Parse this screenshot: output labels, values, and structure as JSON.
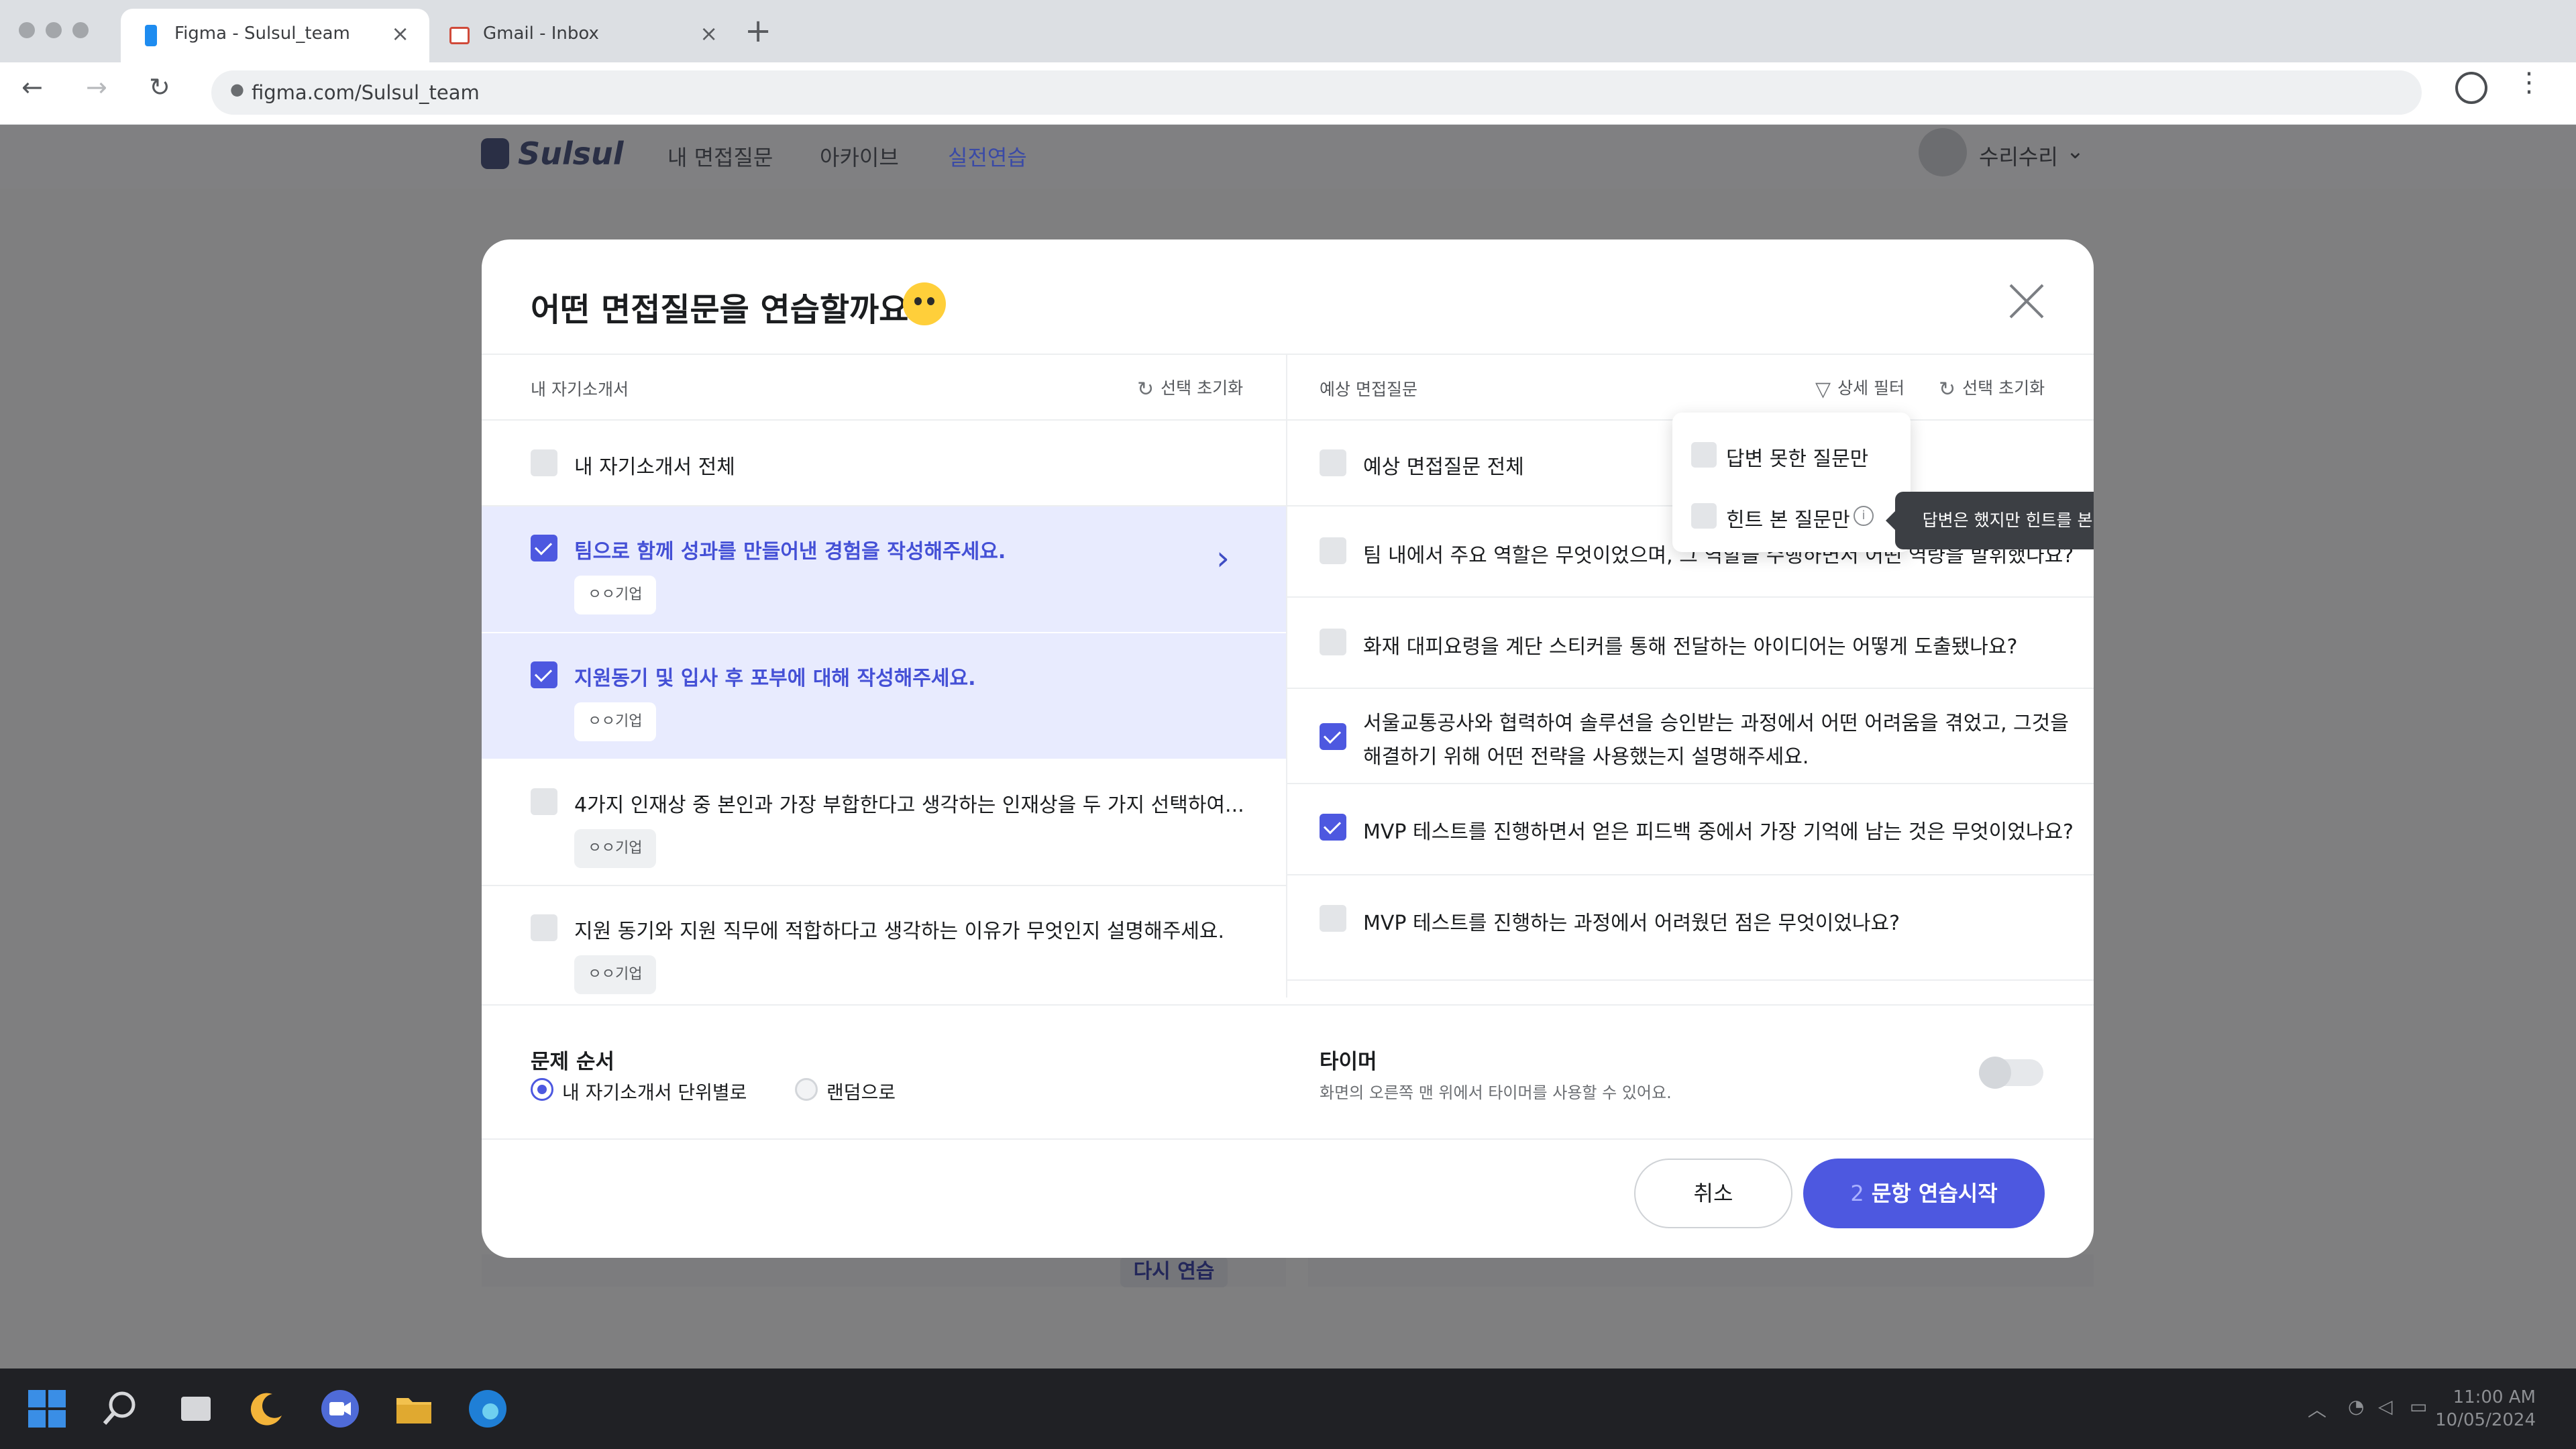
{
  "browser": {
    "tabs": [
      {
        "title": "Figma - Sulsul_team",
        "close": "×"
      },
      {
        "title": "Gmail - Inbox",
        "close": "×"
      }
    ],
    "new_tab": "+",
    "url": "figma.com/Sulsul_team",
    "back": "←",
    "forward": "→",
    "reload": "↻",
    "menu": "⋮"
  },
  "app": {
    "logo": "Sulsul",
    "nav": [
      "내 면접질문",
      "아카이브",
      "실전연습"
    ],
    "active_nav": "실전연습",
    "user": "수리수리",
    "user_chevron": "⌄",
    "retry_label": "다시 연습"
  },
  "modal": {
    "title": "어떤 면접질문을 연습할까요?",
    "left": {
      "header": "내 자기소개서",
      "reset_label": "선택 초기화",
      "all_label": "내 자기소개서 전체",
      "items": [
        {
          "text": "팀으로 함께 성과를 만들어낸 경험을 작성해주세요.",
          "company": "ㅇㅇ기업",
          "checked": true
        },
        {
          "text": "지원동기 및 입사 후 포부에 대해 작성해주세요.",
          "company": "ㅇㅇ기업",
          "checked": true
        },
        {
          "text": "4가지 인재상 중 본인과 가장 부합한다고 생각하는 인재상을 두 가지 선택하여...",
          "company": "ㅇㅇ기업",
          "checked": false
        },
        {
          "text": "지원 동기와 지원 직무에 적합하다고 생각하는 이유가 무엇인지 설명해주세요.",
          "company": "ㅇㅇ기업",
          "checked": false
        }
      ]
    },
    "right": {
      "header": "예상 면접질문",
      "filter_label": "상세 필터",
      "reset_label": "선택 초기화",
      "all_label": "예상 면접질문 전체",
      "items": [
        {
          "lines": [
            "팀 내에서 주요 역할은 무엇이었으며, 그 역할을 수행하면서 어떤 역량을 발휘했나요?"
          ],
          "checked": false
        },
        {
          "lines": [
            "화재 대피요령을 계단 스티커를 통해 전달하는 아이디어는 어떻게 도출됐나요?"
          ],
          "checked": false
        },
        {
          "lines": [
            "서울교통공사와 협력하여 솔루션을 승인받는 과정에서 어떤 어려움을 겪었고, 그것을",
            "해결하기 위해 어떤 전략을 사용했는지 설명해주세요."
          ],
          "checked": true
        },
        {
          "lines": [
            "MVP 테스트를 진행하면서 얻은 피드백 중에서 가장 기억에 남는 것은 무엇이었나요?"
          ],
          "checked": true
        },
        {
          "lines": [
            "MVP 테스트를 진행하는 과정에서 어려웠던 점은 무엇이었나요?"
          ],
          "checked": false
        }
      ]
    },
    "filter_options": [
      "답변 못한 질문만",
      "힌트 본 질문만"
    ],
    "tooltip": "답변은 했지만 힌트를 본 질문도 포함돼요.",
    "order": {
      "label": "문제 순서",
      "options": [
        "내 자기소개서 단위별로",
        "랜덤으로"
      ],
      "selected": "내 자기소개서 단위별로"
    },
    "timer": {
      "label": "타이머",
      "desc": "화면의 오른쪽 맨 위에서 타이머를 사용할 수 있어요.",
      "enabled": false
    },
    "cancel_label": "취소",
    "start_count": "2",
    "start_label": "문항 연습시작"
  },
  "system": {
    "time": "11:00 AM",
    "date": "10/05/2024"
  }
}
